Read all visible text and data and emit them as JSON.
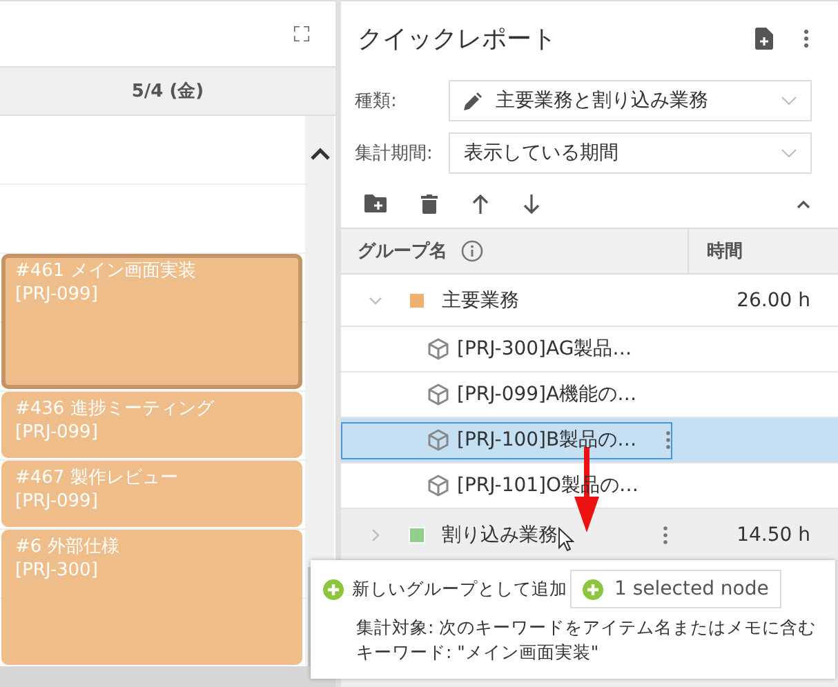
{
  "calendar": {
    "date_header": "5/4 (金)",
    "events": [
      {
        "title": "#461 メイン画面実装",
        "project": "[PRJ-099]",
        "selected": true
      },
      {
        "title": "#436 進捗ミーティング",
        "project": "[PRJ-099]",
        "selected": false
      },
      {
        "title": "#467 製作レビュー",
        "project": "[PRJ-099]",
        "selected": false
      },
      {
        "title": "#6 外部仕様",
        "project": "[PRJ-300]",
        "selected": false
      }
    ]
  },
  "report": {
    "title": "クイックレポート",
    "fields": [
      {
        "label": "種類:",
        "value": "主要業務と割り込み業務",
        "kind": "edit"
      },
      {
        "label": "集計期間:",
        "value": "表示している期間",
        "kind": "plain"
      }
    ],
    "table": {
      "columns": [
        "グループ名",
        "時間"
      ],
      "groups": [
        {
          "name": "主要業務",
          "color": "#f0b070",
          "hours": "26.00 h",
          "expanded": true,
          "hovered": false,
          "children": [
            {
              "name": "[PRJ-300]AG製品…",
              "selected": false
            },
            {
              "name": "[PRJ-099]A機能の…",
              "selected": false
            },
            {
              "name": "[PRJ-100]B製品の…",
              "selected": true
            },
            {
              "name": "[PRJ-101]O製品の…",
              "selected": false
            }
          ]
        },
        {
          "name": "割り込み業務",
          "color": "#90d08a",
          "hours": "14.50 h",
          "expanded": false,
          "hovered": true
        }
      ]
    }
  },
  "drop_popup": {
    "add_group": "新しいグループとして追加",
    "drag_badge": "1 selected node",
    "lines": [
      "集計対象: 次のキーワードをアイテム名またはメモに含む",
      "キーワード: \"メイン画面実装\""
    ]
  }
}
